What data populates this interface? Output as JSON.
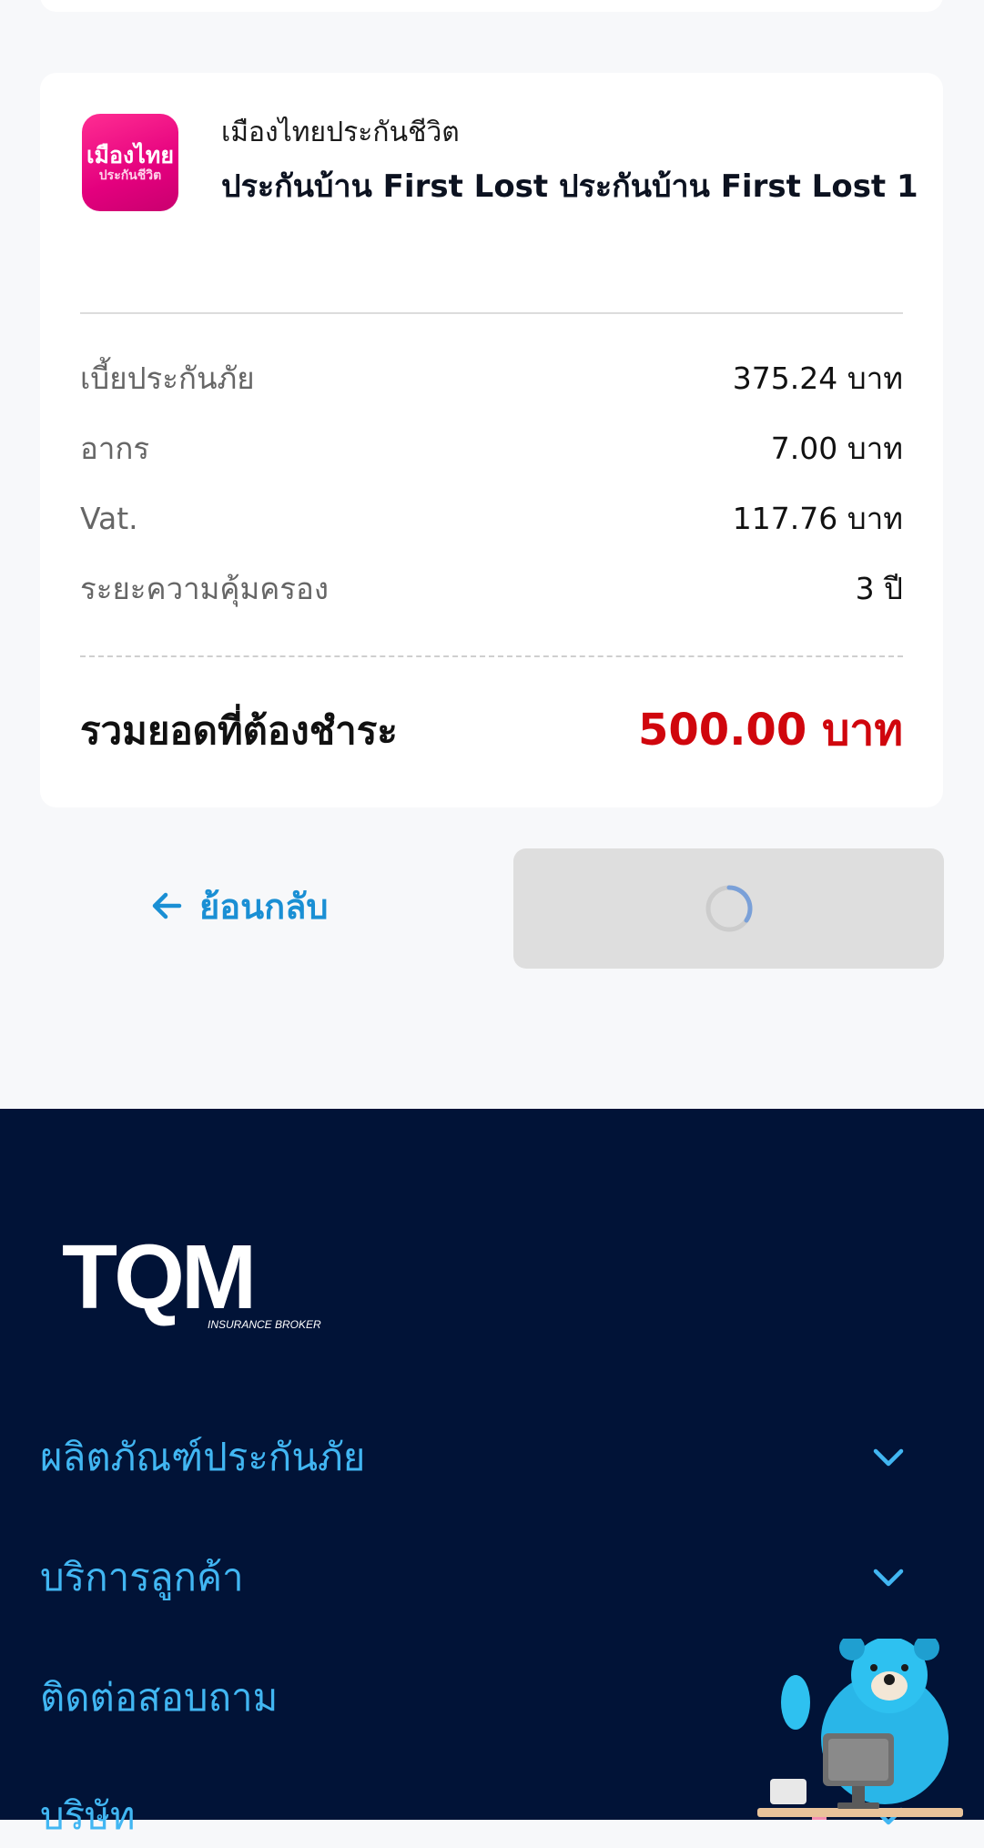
{
  "summary": {
    "insurer_logo_text_line1": "เมืองไทย",
    "insurer_logo_text_line2": "ประกันชีวิต",
    "insurer_name": "เมืองไทยประกันชีวิต",
    "plan_name": "ประกันบ้าน First Lost ประกันบ้าน First Lost 1",
    "fees": [
      {
        "label": "เบี้ยประกันภัย",
        "value": "375.24 บาท"
      },
      {
        "label": "อากร",
        "value": "7.00 บาท"
      },
      {
        "label": "Vat.",
        "value": "117.76 บาท"
      },
      {
        "label": "ระยะความคุ้มครอง",
        "value": "3 ปี"
      }
    ],
    "total_label": "รวมยอดที่ต้องชำระ",
    "total_value": "500.00 บาท"
  },
  "actions": {
    "back_label": "ย้อนกลับ"
  },
  "footer": {
    "logo_text": "TQM",
    "logo_subtext": "INSURANCE BROKER",
    "menu": [
      {
        "label": "ผลิตภัณฑ์ประกันภัย"
      },
      {
        "label": "บริการลูกค้า"
      },
      {
        "label": "ติดต่อสอบถาม"
      },
      {
        "label": "บริษัท"
      }
    ]
  },
  "colors": {
    "accent_blue": "#1a8fd4",
    "total_red": "#d0060d",
    "footer_bg": "#011337",
    "footer_link": "#41b6f2"
  }
}
